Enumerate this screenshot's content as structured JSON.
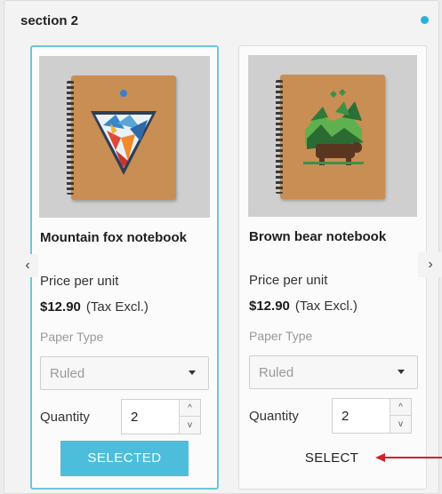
{
  "section": {
    "title": "section 2",
    "accent_color": "#2bb0d6"
  },
  "carousel": {
    "prev_icon": "chevron-left-icon",
    "next_icon": "chevron-right-icon",
    "prev_glyph": "‹",
    "next_glyph": "›"
  },
  "products": [
    {
      "name": "Mountain fox notebook",
      "price_label": "Price per unit",
      "price": "$12.90",
      "tax_note": "(Tax Excl.)",
      "paper_type_label": "Paper Type",
      "paper_type_value": "Ruled",
      "quantity_label": "Quantity",
      "quantity_value": "2",
      "spin_up": "^",
      "spin_down": "v",
      "action_label": "SELECTED",
      "selected": true
    },
    {
      "name": "Brown bear notebook",
      "price_label": "Price per unit",
      "price": "$12.90",
      "tax_note": "(Tax Excl.)",
      "paper_type_label": "Paper Type",
      "paper_type_value": "Ruled",
      "quantity_label": "Quantity",
      "quantity_value": "2",
      "spin_up": "^",
      "spin_down": "v",
      "action_label": "SELECT",
      "selected": false
    }
  ],
  "colors": {
    "selected_button": "#4cbedb",
    "selected_border": "#6cc6dd",
    "annotation_arrow": "#d6202b"
  }
}
